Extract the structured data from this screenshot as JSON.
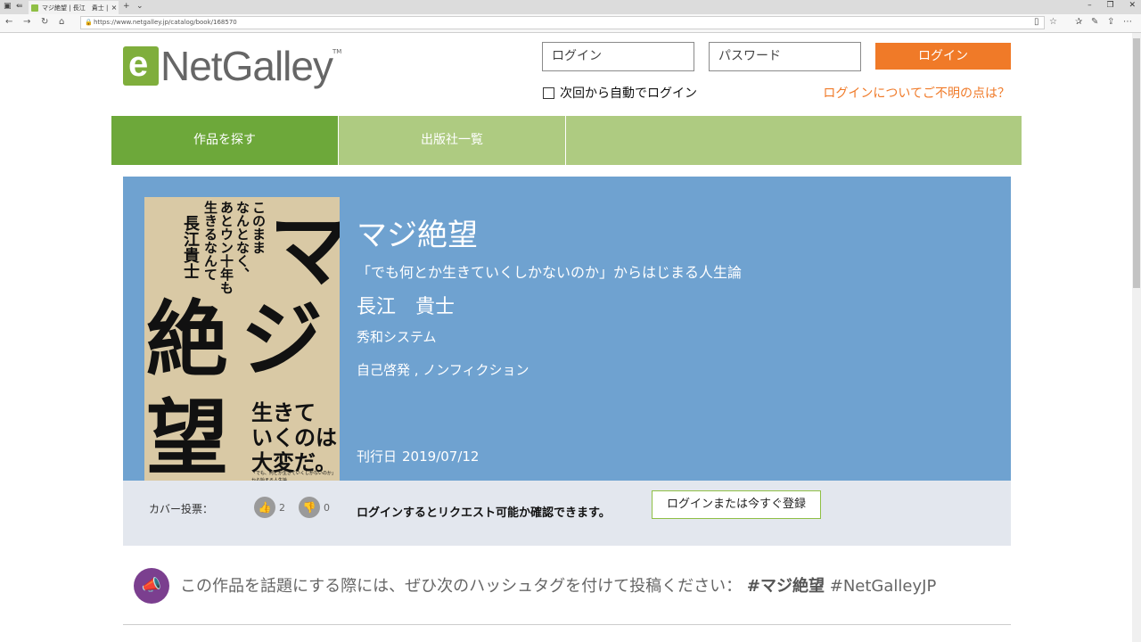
{
  "browser": {
    "tab_title": "マジ絶望 | 長江　貴士 | S",
    "tab_close": "×",
    "new_tab": "+",
    "tab_menu": "⌄",
    "url": "https://www.netgalley.jp/catalog/book/168570"
  },
  "header": {
    "logo_text": "NetGalley",
    "logo_tm": "TM",
    "login_placeholder": "ログイン",
    "password_placeholder": "パスワード",
    "login_button": "ログイン",
    "remember_label": "次回から自動でログイン",
    "help_link": "ログインについてご不明の点は？"
  },
  "nav": {
    "items": [
      {
        "label": "作品を探す"
      },
      {
        "label": "出版社一覧"
      }
    ]
  },
  "book": {
    "title": "マジ絶望",
    "subtitle": "「でも何とか生きていくしかないのか」からはじまる人生論",
    "author": "長江　貴士",
    "publisher": "秀和システム",
    "category": "自己啓発 , ノンフィクション",
    "pubdate_label": "刊行日",
    "pubdate": "2019/07/12",
    "cover": {
      "big_ma": "マ",
      "big_ji": "ジ",
      "big_zetsu": "絶",
      "big_bou": "望",
      "vertical1": "このまま",
      "vertical2": "なんとなく、",
      "vertical3": "あとウン十年も",
      "vertical4": "生きるなんて",
      "author": "長江貴士",
      "tag1": "生きて",
      "tag2": "いくのは",
      "tag3": "大変だ。",
      "small1": "「でも、何とか生きていくしかないのか」",
      "small2": "から始まる人生論"
    }
  },
  "vote": {
    "label": "カバー投票：",
    "up_count": "2",
    "down_count": "0"
  },
  "request": {
    "message": "ログインするとリクエスト可能か確認できます。",
    "button": "ログインまたは今すぐ登録"
  },
  "hashtag": {
    "text": "この作品を話題にする際には、ぜひ次のハッシュタグを付けて投稿ください：",
    "tag1": "#マジ絶望",
    "tag2": "#NetGalleyJP"
  },
  "colors": {
    "brand_green": "#7fae3c",
    "nav_active": "#6da83a",
    "nav_bg": "#aecb81",
    "accent_orange": "#f07a28",
    "hero_blue": "#6fa2d0"
  }
}
